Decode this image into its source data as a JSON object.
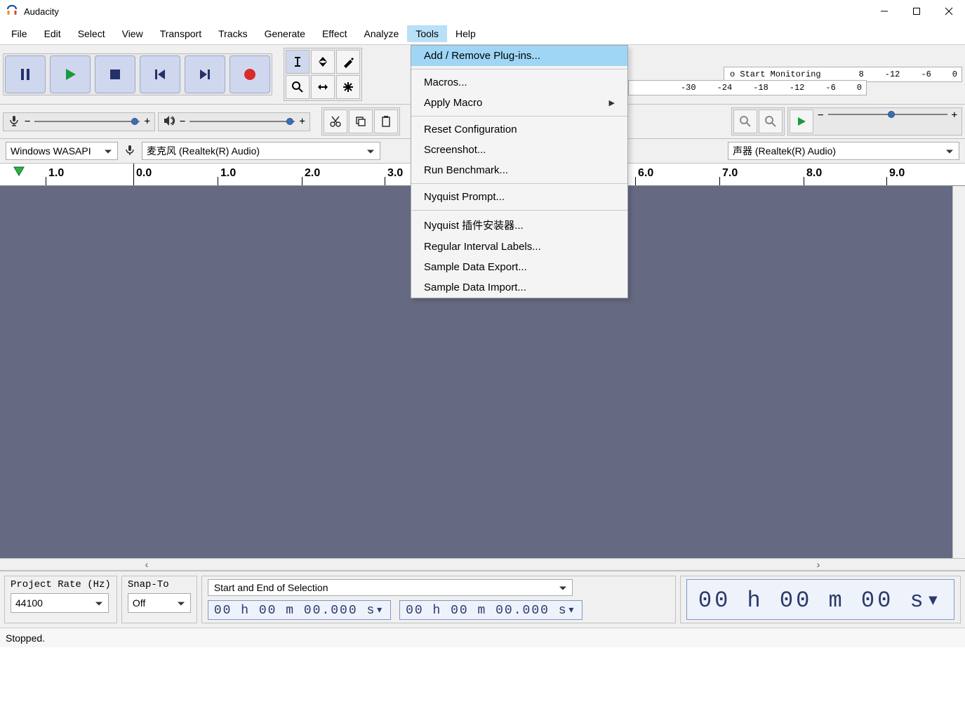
{
  "window": {
    "title": "Audacity"
  },
  "menubar": {
    "items": [
      "File",
      "Edit",
      "Select",
      "View",
      "Transport",
      "Tracks",
      "Generate",
      "Effect",
      "Analyze",
      "Tools",
      "Help"
    ],
    "open_index": 9
  },
  "tools_menu": {
    "items": [
      {
        "label": "Add / Remove Plug-ins...",
        "highlighted": true
      },
      {
        "sep": true
      },
      {
        "label": "Macros..."
      },
      {
        "label": "Apply Macro",
        "submenu": true
      },
      {
        "sep": true
      },
      {
        "label": "Reset Configuration"
      },
      {
        "label": "Screenshot..."
      },
      {
        "label": "Run Benchmark..."
      },
      {
        "sep": true
      },
      {
        "label": "Nyquist Prompt..."
      },
      {
        "sep": true
      },
      {
        "label": "Nyquist 插件安装器..."
      },
      {
        "label": "Regular Interval Labels..."
      },
      {
        "label": "Sample Data Export..."
      },
      {
        "label": "Sample Data Import..."
      }
    ]
  },
  "record_meter": {
    "hint": "o Start Monitoring",
    "ticks": [
      "8",
      "-12",
      "-6",
      "0"
    ]
  },
  "play_meter": {
    "ticks": [
      "-30",
      "-24",
      "-18",
      "-12",
      "-6",
      "0"
    ]
  },
  "devices": {
    "host": "Windows WASAPI",
    "record_device": "麦克风 (Realtek(R) Audio)",
    "play_device": "声器 (Realtek(R) Audio)"
  },
  "timeline": {
    "labels": [
      "1.0",
      "0.0",
      "1.0",
      "2.0",
      "3.0",
      "6.0",
      "7.0",
      "8.0",
      "9.0"
    ],
    "positions": [
      65,
      190,
      310,
      430,
      548,
      905,
      1025,
      1145,
      1263
    ]
  },
  "footer": {
    "project_rate_label": "Project Rate (Hz)",
    "project_rate_value": "44100",
    "snap_to_label": "Snap-To",
    "snap_to_value": "Off",
    "selection_mode": "Start and End of Selection",
    "time_start": "00 h 00 m 00.000 s",
    "time_end": "00 h 00 m 00.000 s",
    "audio_position": "00 h 00 m 00 s"
  },
  "statusbar": {
    "text": "Stopped."
  },
  "volume_sliders": {
    "record": {
      "minus": "−",
      "plus": "+"
    },
    "playback": {
      "minus": "−",
      "plus": "+"
    }
  }
}
